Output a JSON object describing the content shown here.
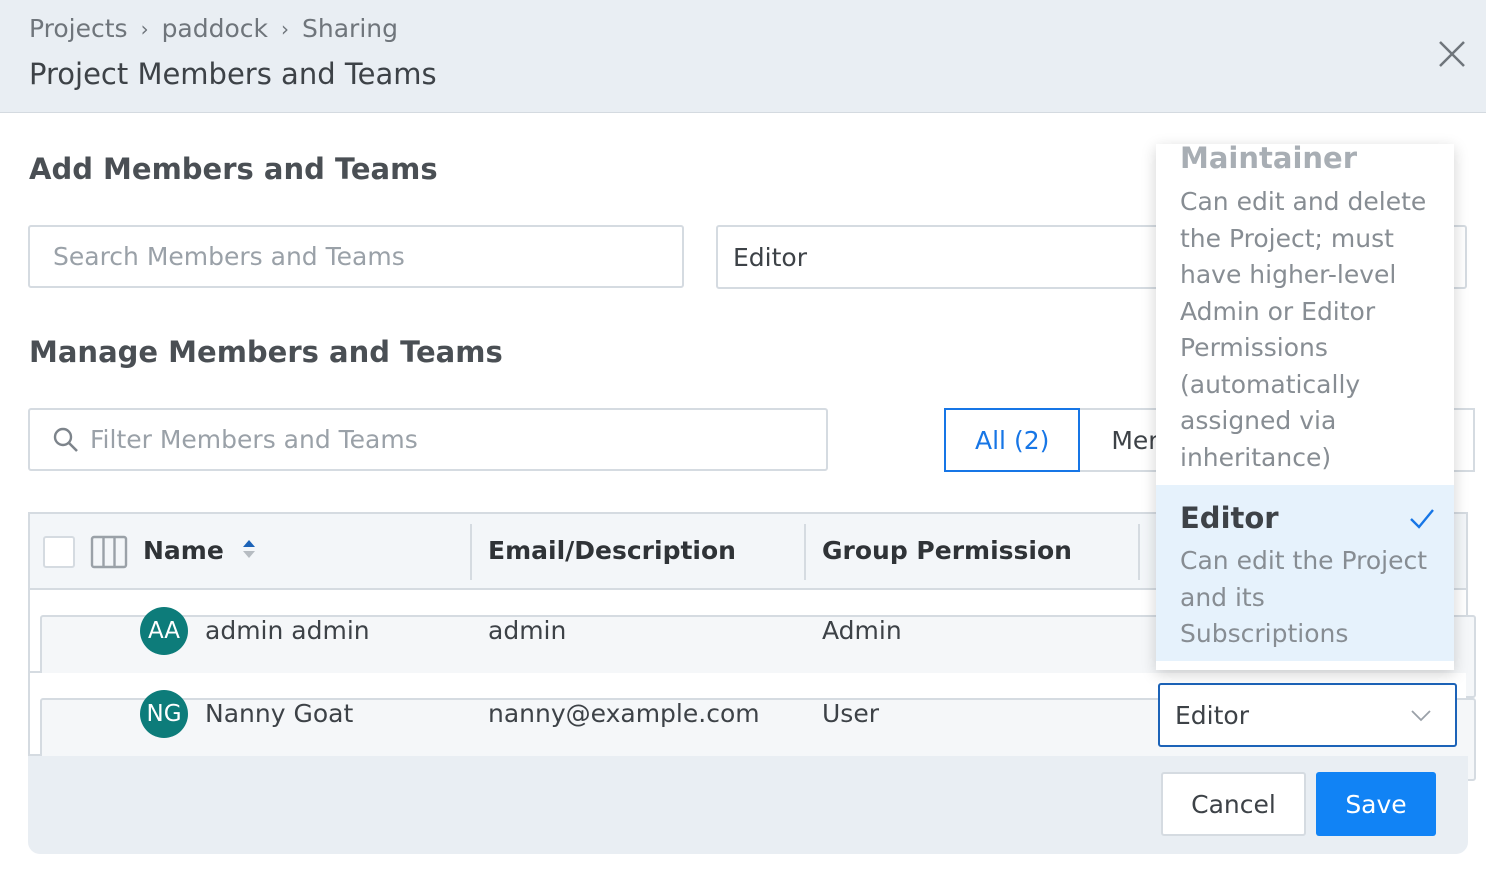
{
  "header": {
    "breadcrumbs": [
      "Projects",
      "paddock",
      "Sharing"
    ],
    "title": "Project Members and Teams"
  },
  "add_section": {
    "title": "Add Members and Teams",
    "search_placeholder": "Search Members and Teams",
    "role_value": "Editor"
  },
  "manage_section": {
    "title": "Manage Members and Teams",
    "filter_placeholder": "Filter Members and Teams",
    "tabs": [
      {
        "label": "All (2)",
        "active": true
      },
      {
        "label": "Mem",
        "active": false
      }
    ]
  },
  "table": {
    "columns": [
      "Name",
      "Email/Description",
      "Group Permission"
    ],
    "rows": [
      {
        "initials": "AA",
        "name": "admin admin",
        "email": "admin",
        "group_permission": "Admin",
        "role": ""
      },
      {
        "initials": "NG",
        "name": "Nanny Goat",
        "email": "nanny@example.com",
        "group_permission": "User",
        "role": "Editor"
      }
    ]
  },
  "role_dropdown": {
    "options": [
      {
        "label": "Maintainer",
        "description_lines": [
          "Can edit and delete",
          "the Project; must",
          "have higher-level",
          "Admin or Editor",
          "Permissions",
          "(automatically",
          "assigned via",
          "inheritance)"
        ],
        "selected": false
      },
      {
        "label": "Editor",
        "description_lines": [
          "Can edit the Project",
          "and its",
          "Subscriptions"
        ],
        "selected": true
      }
    ]
  },
  "footer": {
    "cancel_label": "Cancel",
    "save_label": "Save"
  },
  "colors": {
    "accent": "#1776e6",
    "save_button": "#1183f5",
    "avatar": "#0d7c7a",
    "selected_option_bg": "#e6f2fc"
  }
}
